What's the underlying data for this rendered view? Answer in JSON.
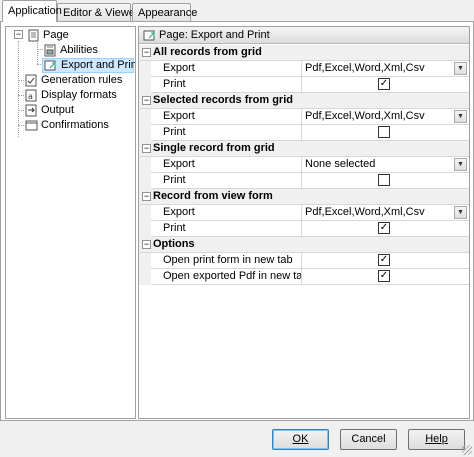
{
  "tabs": [
    {
      "label": "Application",
      "active": true
    },
    {
      "label": "Editor & Viewers",
      "active": false
    },
    {
      "label": "Appearance",
      "active": false
    }
  ],
  "tree": {
    "items": [
      {
        "label": "Page",
        "icon": "page-icon",
        "level": 0,
        "expanded": true
      },
      {
        "label": "Abilities",
        "icon": "abilities-icon",
        "level": 1
      },
      {
        "label": "Export and Print",
        "icon": "export-icon",
        "level": 1,
        "selected": true
      },
      {
        "label": "Generation rules",
        "icon": "rules-icon",
        "level": 0
      },
      {
        "label": "Display formats",
        "icon": "formats-icon",
        "level": 0
      },
      {
        "label": "Output",
        "icon": "output-icon",
        "level": 0
      },
      {
        "label": "Confirmations",
        "icon": "confirm-icon",
        "level": 0
      }
    ]
  },
  "page_header": "Page: Export and Print",
  "grid": {
    "categories": [
      {
        "title": "All records from grid",
        "rows": [
          {
            "name": "Export",
            "type": "dropdown",
            "value": "Pdf,Excel,Word,Xml,Csv"
          },
          {
            "name": "Print",
            "type": "checkbox",
            "checked": true
          }
        ]
      },
      {
        "title": "Selected records from grid",
        "rows": [
          {
            "name": "Export",
            "type": "dropdown",
            "value": "Pdf,Excel,Word,Xml,Csv"
          },
          {
            "name": "Print",
            "type": "checkbox",
            "checked": false
          }
        ]
      },
      {
        "title": "Single record from grid",
        "rows": [
          {
            "name": "Export",
            "type": "dropdown",
            "value": "None selected"
          },
          {
            "name": "Print",
            "type": "checkbox",
            "checked": false
          }
        ]
      },
      {
        "title": "Record from view form",
        "rows": [
          {
            "name": "Export",
            "type": "dropdown",
            "value": "Pdf,Excel,Word,Xml,Csv"
          },
          {
            "name": "Print",
            "type": "checkbox",
            "checked": true
          }
        ]
      },
      {
        "title": "Options",
        "rows": [
          {
            "name": "Open print form in new tab",
            "type": "checkbox",
            "checked": true
          },
          {
            "name": "Open exported Pdf in new tab",
            "type": "checkbox",
            "checked": true
          }
        ]
      }
    ]
  },
  "buttons": {
    "ok": "OK",
    "cancel": "Cancel",
    "help": "Help"
  },
  "glyphs": {
    "check": "✓",
    "minus": "−",
    "dropdown": "▼"
  }
}
